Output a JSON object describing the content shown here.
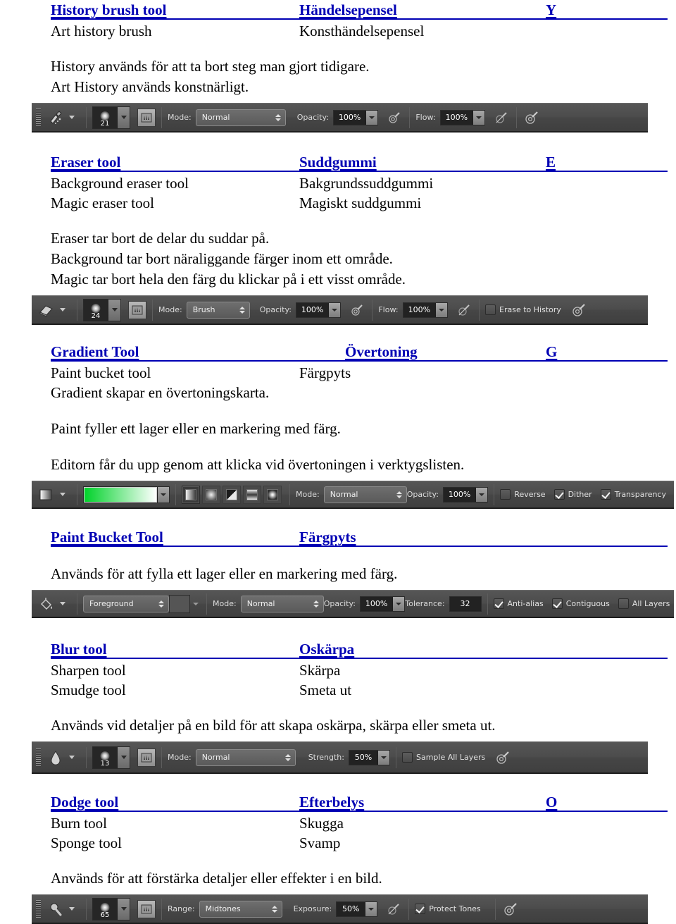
{
  "document": {
    "sections": [
      {
        "id": "history-brush",
        "heading": {
          "en": "History brush tool",
          "sv": "Händelsepensel",
          "key": "Y"
        },
        "subrows": [
          {
            "en": "Art history brush",
            "sv": "Konsthändelsepensel",
            "key": ""
          }
        ],
        "paragraphs": [
          "History används för att ta bort steg man gjort tidigare.",
          "Art History används konstnärligt."
        ],
        "toolbar": {
          "name": "history-brush-options-bar",
          "tool_icon": "history-brush-icon",
          "brush_size": "21",
          "mode_label": "Mode:",
          "mode_value": "Normal",
          "opacity_label": "Opacity:",
          "opacity_value": "100%",
          "flow_label": "Flow:",
          "flow_value": "100%"
        }
      },
      {
        "id": "eraser",
        "heading": {
          "en": "Eraser tool",
          "sv": "Suddgummi",
          "key": "E"
        },
        "subrows": [
          {
            "en": "Background eraser tool",
            "sv": "Bakgrundssuddgummi",
            "key": ""
          },
          {
            "en": "Magic eraser tool",
            "sv": "Magiskt suddgummi",
            "key": ""
          }
        ],
        "paragraphs": [
          "Eraser tar bort de delar du suddar på.",
          "Background tar bort näraliggande färger inom ett område.",
          "Magic tar bort hela den färg du klickar på i ett visst område."
        ],
        "toolbar": {
          "name": "eraser-options-bar",
          "tool_icon": "eraser-icon",
          "brush_size": "24",
          "mode_label": "Mode:",
          "mode_value": "Brush",
          "opacity_label": "Opacity:",
          "opacity_value": "100%",
          "flow_label": "Flow:",
          "flow_value": "100%",
          "erase_to_history_label": "Erase to History",
          "erase_to_history_checked": false
        }
      },
      {
        "id": "gradient",
        "heading": {
          "en": "Gradient Tool",
          "sv": "Övertoning",
          "key": "G"
        },
        "subrows": [
          {
            "en": "Paint bucket tool",
            "sv": "Färgpyts",
            "key": ""
          }
        ],
        "paragraphs": [
          "Gradient skapar en övertoningskarta.",
          "Paint fyller ett lager eller en markering med färg.",
          "Editorn får du upp genom att klicka vid övertoningen i verktygslisten."
        ],
        "toolbar": {
          "name": "gradient-options-bar",
          "tool_icon": "gradient-icon",
          "gradient_preview_from": "#00d22a",
          "gradient_preview_to": "#ffffff",
          "gradient_types": [
            "linear",
            "radial",
            "angle",
            "reflected",
            "diamond"
          ],
          "gradient_type_active": "linear",
          "mode_label": "Mode:",
          "mode_value": "Normal",
          "opacity_label": "Opacity:",
          "opacity_value": "100%",
          "reverse_label": "Reverse",
          "reverse_checked": false,
          "dither_label": "Dither",
          "dither_checked": true,
          "transparency_label": "Transparency",
          "transparency_checked": true
        }
      },
      {
        "id": "paint-bucket",
        "heading": {
          "en": "Paint Bucket Tool",
          "sv": "Färgpyts",
          "key": ""
        },
        "subrows": [],
        "paragraphs": [
          "Används för att fylla ett lager eller en markering med färg."
        ],
        "toolbar": {
          "name": "paint-bucket-options-bar",
          "tool_icon": "paint-bucket-icon",
          "fill_source_value": "Foreground",
          "mode_label": "Mode:",
          "mode_value": "Normal",
          "opacity_label": "Opacity:",
          "opacity_value": "100%",
          "tolerance_label": "Tolerance:",
          "tolerance_value": "32",
          "antialias_label": "Anti-alias",
          "antialias_checked": true,
          "contiguous_label": "Contiguous",
          "contiguous_checked": true,
          "all_layers_label": "All Layers",
          "all_layers_checked": false
        }
      },
      {
        "id": "blur",
        "heading": {
          "en": "Blur tool",
          "sv": "Oskärpa",
          "key": ""
        },
        "subrows": [
          {
            "en": "Sharpen tool",
            "sv": "Skärpa",
            "key": ""
          },
          {
            "en": "Smudge tool",
            "sv": "Smeta ut",
            "key": ""
          }
        ],
        "paragraphs": [
          "Används vid detaljer på en bild för att skapa oskärpa, skärpa eller smeta ut."
        ],
        "toolbar": {
          "name": "blur-options-bar",
          "tool_icon": "blur-droplet-icon",
          "brush_size": "13",
          "mode_label": "Mode:",
          "mode_value": "Normal",
          "strength_label": "Strength:",
          "strength_value": "50%",
          "sample_all_layers_label": "Sample All Layers",
          "sample_all_layers_checked": false
        }
      },
      {
        "id": "dodge",
        "heading": {
          "en": "Dodge tool",
          "sv": "Efterbelys",
          "key": "O"
        },
        "subrows": [
          {
            "en": "Burn tool",
            "sv": "Skugga",
            "key": ""
          },
          {
            "en": "Sponge tool",
            "sv": "Svamp",
            "key": ""
          }
        ],
        "paragraphs": [
          "Används för att förstärka detaljer eller effekter i en bild."
        ],
        "toolbar": {
          "name": "dodge-options-bar",
          "tool_icon": "dodge-icon",
          "brush_size": "65",
          "range_label": "Range:",
          "range_value": "Midtones",
          "exposure_label": "Exposure:",
          "exposure_value": "50%",
          "protect_tones_label": "Protect Tones",
          "protect_tones_checked": true
        }
      }
    ]
  },
  "colors": {
    "heading_blue": "#0000b4",
    "bar_background": "#4e4e4e",
    "bar_text": "#d8d8d8"
  }
}
